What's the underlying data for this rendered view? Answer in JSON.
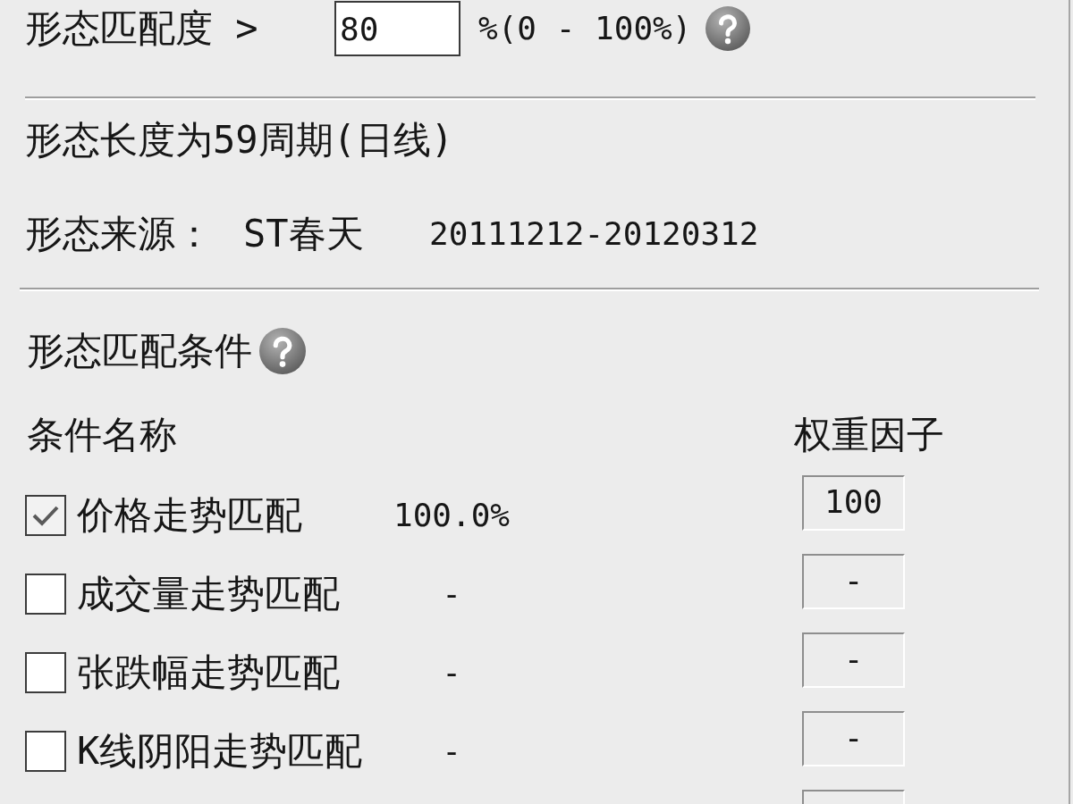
{
  "similarity": {
    "label": "形态匹配度 >",
    "value": "80",
    "range": "%(0 - 100%)"
  },
  "pattern_length": "形态长度为59周期(日线)",
  "pattern_source": {
    "label": "形态来源：",
    "stock": "ST春天",
    "date_range": "20111212-20120312"
  },
  "conditions_section": {
    "title": "形态匹配条件",
    "columns": [
      "条件名称",
      "权重因子"
    ],
    "rows": [
      {
        "kind": "condition",
        "name": "价格走势匹配",
        "checked": true,
        "match": "100.0%",
        "weight": "100"
      },
      {
        "kind": "condition",
        "name": "成交量走势匹配",
        "checked": false,
        "match": "-",
        "weight": "-"
      },
      {
        "kind": "condition",
        "name": "张跌幅走势匹配",
        "checked": false,
        "match": "-",
        "weight": "-"
      },
      {
        "kind": "condition",
        "name": "K线阴阳走势匹配",
        "checked": false,
        "match": "-",
        "weight": "-"
      },
      {
        "kind": "partial"
      }
    ]
  }
}
